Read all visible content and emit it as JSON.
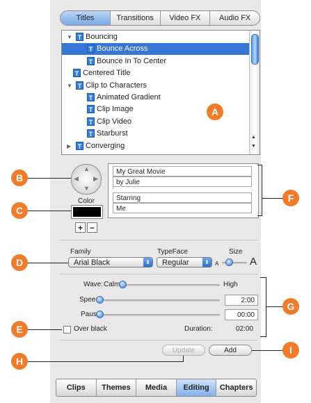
{
  "tabs": [
    "Titles",
    "Transitions",
    "Video FX",
    "Audio FX"
  ],
  "tree": [
    {
      "label": "Bouncing",
      "level": 0,
      "expander": "open",
      "selected": false
    },
    {
      "label": "Bounce Across",
      "level": 1,
      "expander": "none",
      "selected": true
    },
    {
      "label": "Bounce In To Center",
      "level": 1,
      "expander": "none",
      "selected": false
    },
    {
      "label": "Centered Title",
      "level": 0,
      "expander": "none",
      "selected": false
    },
    {
      "label": "Clip to Characters",
      "level": 0,
      "expander": "open",
      "selected": false
    },
    {
      "label": "Animated Gradient",
      "level": 1,
      "expander": "none",
      "selected": false
    },
    {
      "label": "Clip Image",
      "level": 1,
      "expander": "none",
      "selected": false
    },
    {
      "label": "Clip Video",
      "level": 1,
      "expander": "none",
      "selected": false
    },
    {
      "label": "Starburst",
      "level": 1,
      "expander": "none",
      "selected": false
    },
    {
      "label": "Converging",
      "level": 0,
      "expander": "closed",
      "selected": false
    }
  ],
  "tree_icon_letter": "T",
  "callouts": {
    "a": "A",
    "b": "B",
    "c": "C",
    "d": "D",
    "e": "E",
    "f": "F",
    "g": "G",
    "h": "H",
    "i": "I"
  },
  "color_label": "Color",
  "color_swatch": "#000000",
  "plus_label": "+",
  "minus_label": "−",
  "text_fields": [
    "My Great Movie",
    "by Julie",
    "Starring",
    "Me"
  ],
  "font": {
    "family_label": "Family",
    "family_value": "Arial Black",
    "typeface_label": "TypeFace",
    "typeface_value": "Regular",
    "size_label": "Size",
    "size_small": "A",
    "size_large": "A",
    "size_level": 0.2
  },
  "wave": {
    "label": "Wave:",
    "min_label": "Calm",
    "max_label": "High",
    "level": 0.0
  },
  "speed": {
    "label": "Speed:",
    "value": "2:00",
    "level": 0.0
  },
  "pause": {
    "label": "Pause:",
    "value": "00:00",
    "level": 0.0
  },
  "over_black_label": "Over black",
  "over_black_checked": false,
  "duration_label": "Duration:",
  "duration_value": "02:00",
  "update_label": "Update",
  "add_label": "Add",
  "bottom_tabs": [
    "Clips",
    "Themes",
    "Media",
    "Editing",
    "Chapters"
  ],
  "bottom_active": "Editing",
  "colors": {
    "accent": "#3876d4",
    "callout": "#f07c2a",
    "panel": "#e8e8e8"
  }
}
